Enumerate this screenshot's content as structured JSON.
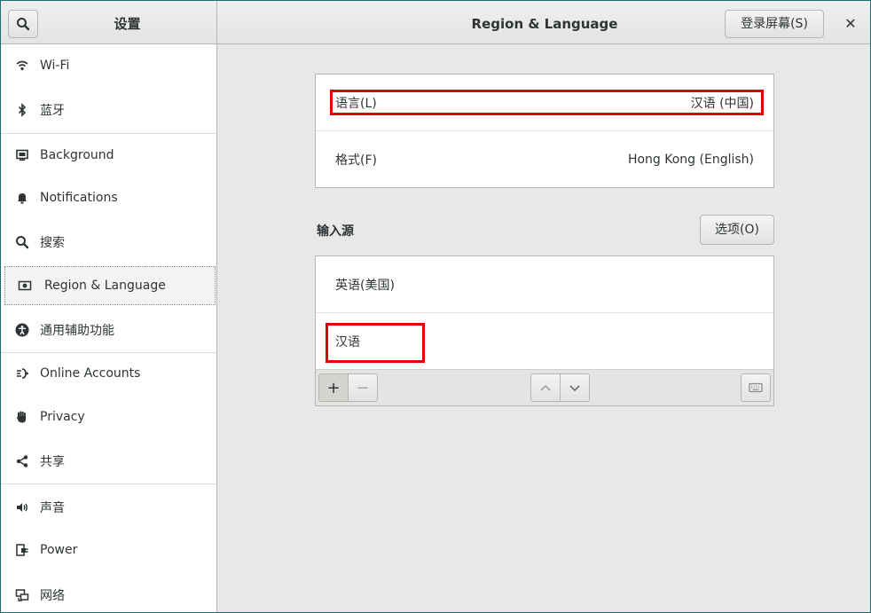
{
  "header": {
    "left_title": "设置",
    "main_title": "Region & Language",
    "login_screen_button": "登录屏幕(S)",
    "close_glyph": "✕"
  },
  "sidebar": {
    "items": [
      {
        "label": "Wi-Fi",
        "icon": "wifi-icon"
      },
      {
        "label": "蓝牙",
        "icon": "bluetooth-icon"
      },
      {
        "label": "Background",
        "icon": "background-icon"
      },
      {
        "label": "Notifications",
        "icon": "bell-icon"
      },
      {
        "label": "搜索",
        "icon": "search-icon"
      },
      {
        "label": "Region & Language",
        "icon": "region-language-icon",
        "selected": true
      },
      {
        "label": "通用辅助功能",
        "icon": "accessibility-icon"
      },
      {
        "label": "Online Accounts",
        "icon": "online-accounts-icon"
      },
      {
        "label": "Privacy",
        "icon": "hand-icon"
      },
      {
        "label": "共享",
        "icon": "share-icon"
      },
      {
        "label": "声音",
        "icon": "speaker-icon"
      },
      {
        "label": "Power",
        "icon": "power-icon"
      },
      {
        "label": "网络",
        "icon": "network-icon"
      }
    ]
  },
  "region": {
    "language_label": "语言(L)",
    "language_value": "汉语 (中国)",
    "formats_label": "格式(F)",
    "formats_value": "Hong Kong (English)"
  },
  "input_sources": {
    "section_label": "输入源",
    "options_button": "选项(O)",
    "sources": [
      "英语(美国)",
      "汉语"
    ],
    "toolbar": {
      "add": "+",
      "remove": "−",
      "up": "up-arrow-icon",
      "down": "down-arrow-icon",
      "keyboard": "keyboard-icon"
    }
  },
  "colors": {
    "highlight": "#e00000",
    "window_border": "#1e6a78",
    "background": "#e8e8e7"
  }
}
